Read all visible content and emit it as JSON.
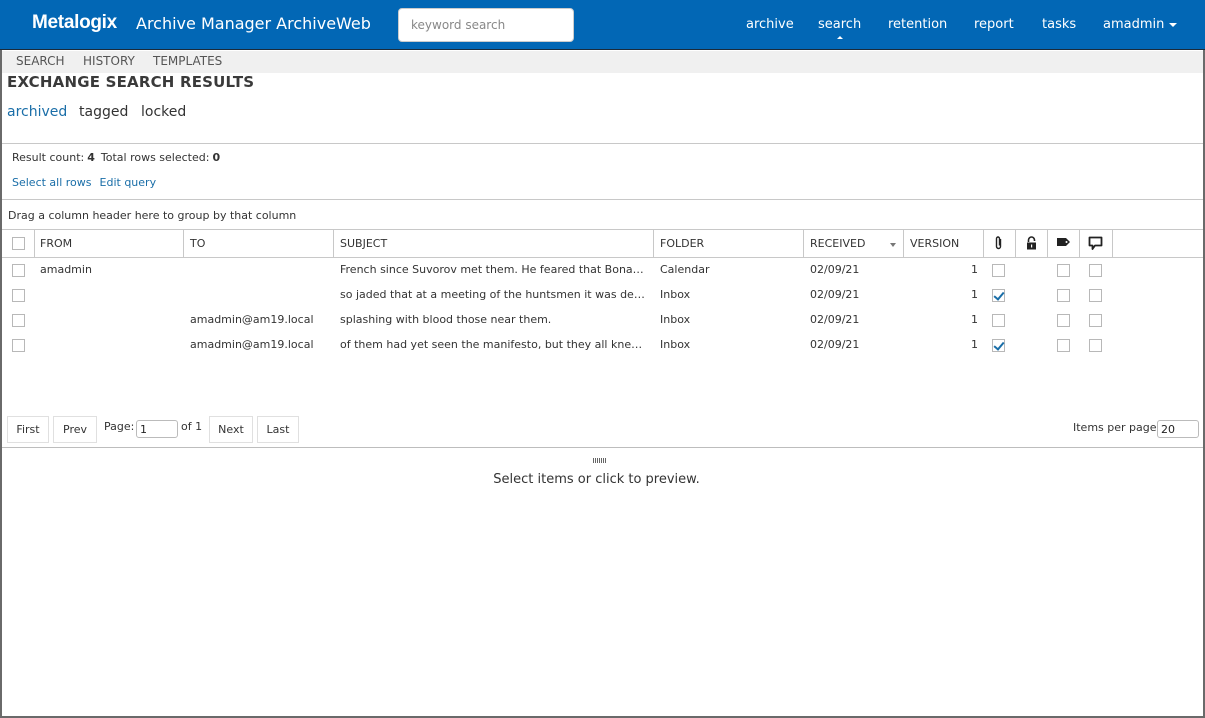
{
  "header": {
    "brand": "Metalogix",
    "app_title": "Archive Manager ArchiveWeb",
    "search_placeholder": "keyword search",
    "nav": [
      {
        "label": "archive",
        "active": false
      },
      {
        "label": "search",
        "active": true
      },
      {
        "label": "retention",
        "active": false
      },
      {
        "label": "report",
        "active": false
      },
      {
        "label": "tasks",
        "active": false
      },
      {
        "label": "amadmin",
        "active": false,
        "dropdown": true
      }
    ],
    "accent_color": "#0267b5"
  },
  "subnav": [
    "SEARCH",
    "HISTORY",
    "TEMPLATES"
  ],
  "page_title": "EXCHANGE SEARCH RESULTS",
  "filter_tabs": [
    {
      "label": "archived",
      "active": true
    },
    {
      "label": "tagged",
      "active": false
    },
    {
      "label": "locked",
      "active": false
    }
  ],
  "results": {
    "result_count_label": "Result count:",
    "result_count": "4",
    "rows_selected_label": "Total rows selected:",
    "rows_selected": "0",
    "select_all_label": "Select all rows",
    "edit_query_label": "Edit query",
    "group_hint": "Drag a column header here to group by that column",
    "columns": [
      "FROM",
      "TO",
      "SUBJECT",
      "FOLDER",
      "RECEIVED",
      "VERSION"
    ],
    "icon_columns": [
      "attachment-icon",
      "lock-icon",
      "tag-icon",
      "comment-icon"
    ],
    "sorted_column": "RECEIVED",
    "rows": [
      {
        "selected": false,
        "from": "amadmin",
        "to": "",
        "subject": "French since Suvorov met them. He feared that Bonapart...",
        "folder": "Calendar",
        "received": "02/09/21",
        "version": "1",
        "attachment": false,
        "tagged": false,
        "comment": false
      },
      {
        "selected": false,
        "from": "",
        "to": "",
        "subject": "so jaded that at a meeting of the huntsmen it was decide...",
        "folder": "Inbox",
        "received": "02/09/21",
        "version": "1",
        "attachment": true,
        "tagged": false,
        "comment": false
      },
      {
        "selected": false,
        "from": "",
        "to": "amadmin@am19.local",
        "subject": "splashing with blood those near them.",
        "folder": "Inbox",
        "received": "02/09/21",
        "version": "1",
        "attachment": false,
        "tagged": false,
        "comment": false
      },
      {
        "selected": false,
        "from": "",
        "to": "amadmin@am19.local",
        "subject": "of them had yet seen the manifesto, but they all knew it ...",
        "folder": "Inbox",
        "received": "02/09/21",
        "version": "1",
        "attachment": true,
        "tagged": false,
        "comment": false
      }
    ]
  },
  "pager": {
    "first": "First",
    "prev": "Prev",
    "page_label": "Page:",
    "page_value": "1",
    "of_label": "of 1",
    "next": "Next",
    "last": "Last",
    "items_per_page_label": "Items per page:",
    "items_per_page": "20"
  },
  "preview_message": "Select items or click to preview."
}
